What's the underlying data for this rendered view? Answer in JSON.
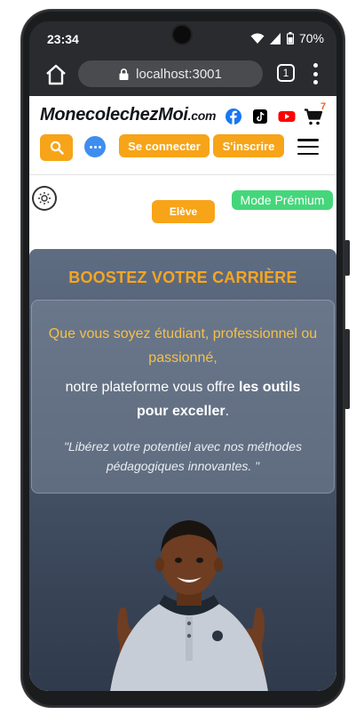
{
  "status_bar": {
    "time": "23:34",
    "battery": "70%"
  },
  "browser": {
    "url": "localhost:3001",
    "tab_count": "1"
  },
  "header": {
    "logo_main": "MonecolechezMoi",
    "logo_domain": ".com",
    "cart_count": "7",
    "login_label": "Se connecter",
    "signup_label": "S'inscrire"
  },
  "role": {
    "eleve_label": "Elève",
    "premium_label": "Mode Prémium"
  },
  "hero": {
    "title": "BOOSTEZ VOTRE CARRIÈRE",
    "line1": "Que vous soyez étudiant, professionnel ou passionné,",
    "line2_prefix": "notre plateforme vous offre ",
    "line2_bold": "les outils pour exceller",
    "line2_suffix": ".",
    "quote": "\"Libérez votre potentiel avec nos méthodes pédagogiques innovantes. \""
  },
  "colors": {
    "accent": "#f7a418",
    "premium": "#45d67a",
    "hero_title": "#f5a623"
  }
}
